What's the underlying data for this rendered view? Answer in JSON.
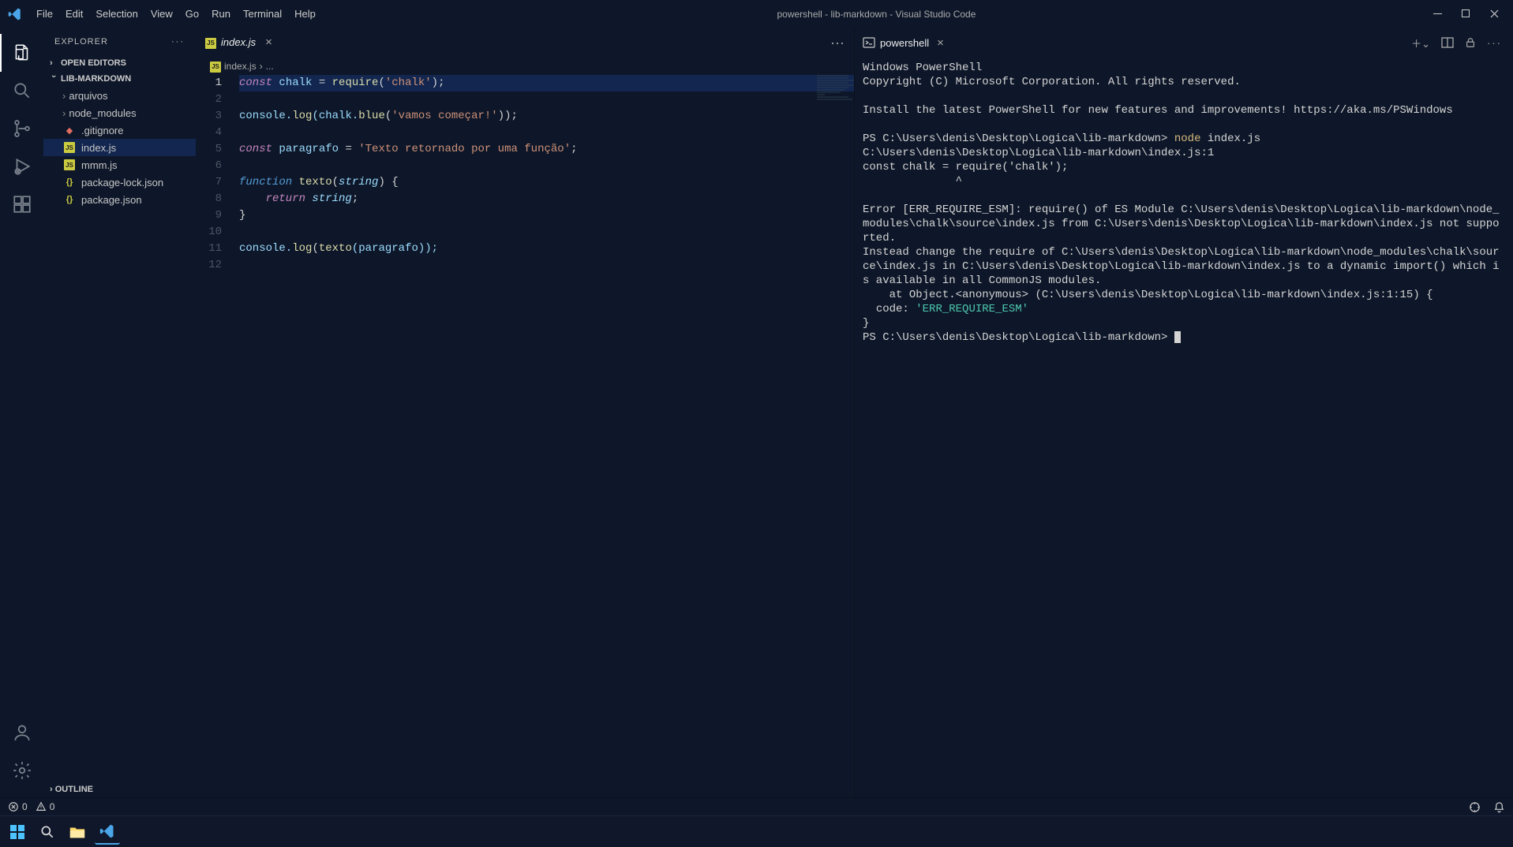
{
  "window": {
    "title": "powershell - lib-markdown - Visual Studio Code"
  },
  "menu": {
    "file": "File",
    "edit": "Edit",
    "selection": "Selection",
    "view": "View",
    "go": "Go",
    "run": "Run",
    "terminal": "Terminal",
    "help": "Help"
  },
  "sidebar": {
    "title": "EXPLORER",
    "open_editors": "OPEN EDITORS",
    "project": "LIB-MARKDOWN",
    "files": {
      "arquivos": "arquivos",
      "node_modules": "node_modules",
      "gitignore": ".gitignore",
      "indexjs": "index.js",
      "mmmjs": "mmm.js",
      "pkglock": "package-lock.json",
      "pkg": "package.json"
    },
    "outline": "OUTLINE"
  },
  "tab": {
    "name": "index.js"
  },
  "breadcrumb": {
    "file": "index.js",
    "more": "..."
  },
  "code": {
    "l1a": "const",
    "l1b": " chalk ",
    "l1c": "=",
    "l1d": " require",
    "l1e": "(",
    "l1f": "'chalk'",
    "l1g": ");",
    "l3a": "console.",
    "l3b": "log",
    "l3c": "(chalk.",
    "l3d": "blue",
    "l3e": "(",
    "l3f": "'vamos começar!'",
    "l3g": "));",
    "l5a": "const",
    "l5b": " paragrafo ",
    "l5c": "=",
    "l5d": " 'Texto retornado por uma função'",
    "l5e": ";",
    "l7a": "function",
    "l7b": " texto",
    "l7c": "(",
    "l7d": "string",
    "l7e": ") {",
    "l8a": "    return",
    "l8b": " string",
    "l8c": ";",
    "l9a": "}",
    "l11a": "console.",
    "l11b": "log",
    "l11c": "(",
    "l11d": "texto",
    "l11e": "(paragrafo));"
  },
  "lines": {
    "n1": "1",
    "n2": "2",
    "n3": "3",
    "n4": "4",
    "n5": "5",
    "n6": "6",
    "n7": "7",
    "n8": "8",
    "n9": "9",
    "n10": "10",
    "n11": "11",
    "n12": "12"
  },
  "terminal": {
    "tab": "powershell",
    "l1": "Windows PowerShell",
    "l2": "Copyright (C) Microsoft Corporation. All rights reserved.",
    "l3": "Install the latest PowerShell for new features and improvements! https://aka.ms/PSWindows",
    "l4a": "PS C:\\Users\\denis\\Desktop\\Logica\\lib-markdown> ",
    "l4b": "node",
    "l4c": " index.js",
    "l5": "C:\\Users\\denis\\Desktop\\Logica\\lib-markdown\\index.js:1",
    "l6": "const chalk = require('chalk');",
    "l7": "              ^",
    "l8": "Error [ERR_REQUIRE_ESM]: require() of ES Module C:\\Users\\denis\\Desktop\\Logica\\lib-markdown\\node_modules\\chalk\\source\\index.js from C:\\Users\\denis\\Desktop\\Logica\\lib-markdown\\index.js not supported.",
    "l9": "Instead change the require of C:\\Users\\denis\\Desktop\\Logica\\lib-markdown\\node_modules\\chalk\\source\\index.js in C:\\Users\\denis\\Desktop\\Logica\\lib-markdown\\index.js to a dynamic import() which is available in all CommonJS modules.",
    "l10": "    at Object.<anonymous> (C:\\Users\\denis\\Desktop\\Logica\\lib-markdown\\index.js:1:15) {",
    "l11a": "  code: ",
    "l11b": "'ERR_REQUIRE_ESM'",
    "l12": "}",
    "l13": "PS C:\\Users\\denis\\Desktop\\Logica\\lib-markdown> "
  },
  "status": {
    "errors": "0",
    "warnings": "0"
  }
}
